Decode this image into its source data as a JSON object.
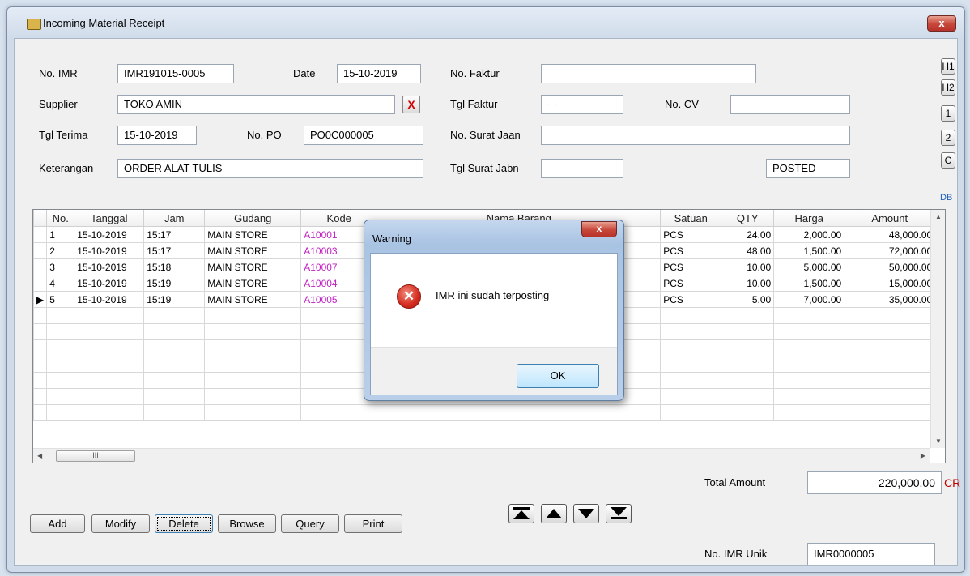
{
  "window": {
    "title": "Incoming Material Receipt",
    "close_label": "x"
  },
  "form": {
    "no_imr": {
      "label": "No. IMR",
      "value": "IMR191015-0005"
    },
    "date": {
      "label": "Date",
      "value": "15-10-2019"
    },
    "no_faktur": {
      "label": "No. Faktur",
      "value": ""
    },
    "supplier": {
      "label": "Supplier",
      "value": "TOKO AMIN",
      "clear_label": "X"
    },
    "tgl_faktur": {
      "label": "Tgl Faktur",
      "value": "- -"
    },
    "no_cv": {
      "label": "No. CV",
      "value": ""
    },
    "tgl_terima": {
      "label": "Tgl Terima",
      "value": "15-10-2019"
    },
    "no_po": {
      "label": "No. PO",
      "value": "PO0C000005"
    },
    "no_surat_jalan": {
      "label": "No. Surat Jaan",
      "value": ""
    },
    "keterangan": {
      "label": "Keterangan",
      "value": "ORDER ALAT TULIS"
    },
    "tgl_surat_jalan": {
      "label": "Tgl Surat Jabn",
      "value": ""
    },
    "status": "POSTED"
  },
  "side_buttons": [
    "H1",
    "H2",
    "1",
    "2",
    "C"
  ],
  "db_label": "DB",
  "grid": {
    "columns": [
      "No.",
      "Tanggal",
      "Jam",
      "Gudang",
      "Kode",
      "Nama Barang",
      "Satuan",
      "QTY",
      "Harga",
      "Amount"
    ],
    "rows": [
      {
        "no": "1",
        "tanggal": "15-10-2019",
        "jam": "15:17",
        "gudang": "MAIN STORE",
        "kode": "A10001",
        "nama": "",
        "satuan": "PCS",
        "qty": "24.00",
        "harga": "2,000.00",
        "amount": "48,000.00"
      },
      {
        "no": "2",
        "tanggal": "15-10-2019",
        "jam": "15:17",
        "gudang": "MAIN STORE",
        "kode": "A10003",
        "nama": "",
        "satuan": "PCS",
        "qty": "48.00",
        "harga": "1,500.00",
        "amount": "72,000.00"
      },
      {
        "no": "3",
        "tanggal": "15-10-2019",
        "jam": "15:18",
        "gudang": "MAIN STORE",
        "kode": "A10007",
        "nama": "",
        "satuan": "PCS",
        "qty": "10.00",
        "harga": "5,000.00",
        "amount": "50,000.00"
      },
      {
        "no": "4",
        "tanggal": "15-10-2019",
        "jam": "15:19",
        "gudang": "MAIN STORE",
        "kode": "A10004",
        "nama": "",
        "satuan": "PCS",
        "qty": "10.00",
        "harga": "1,500.00",
        "amount": "15,000.00"
      },
      {
        "no": "5",
        "tanggal": "15-10-2019",
        "jam": "15:19",
        "gudang": "MAIN STORE",
        "kode": "A10005",
        "nama": "",
        "satuan": "PCS",
        "qty": "5.00",
        "harga": "7,000.00",
        "amount": "35,000.00"
      }
    ],
    "current_row_marker": "▶",
    "hscroll_thumb": "III"
  },
  "totals": {
    "label": "Total Amount",
    "value": "220,000.00",
    "suffix": "CR"
  },
  "unique": {
    "label": "No. IMR Unik",
    "value": "IMR0000005"
  },
  "buttons": {
    "add": "Add",
    "modify": "Modify",
    "delete": "Delete",
    "browse": "Browse",
    "query": "Query",
    "print": "Print"
  },
  "nav": [
    "first-record",
    "previous-record",
    "next-record",
    "last-record"
  ],
  "dialog": {
    "title": "Warning",
    "close_label": "x",
    "message": "IMR ini sudah terposting",
    "ok_label": "OK",
    "icon": "error-icon"
  }
}
